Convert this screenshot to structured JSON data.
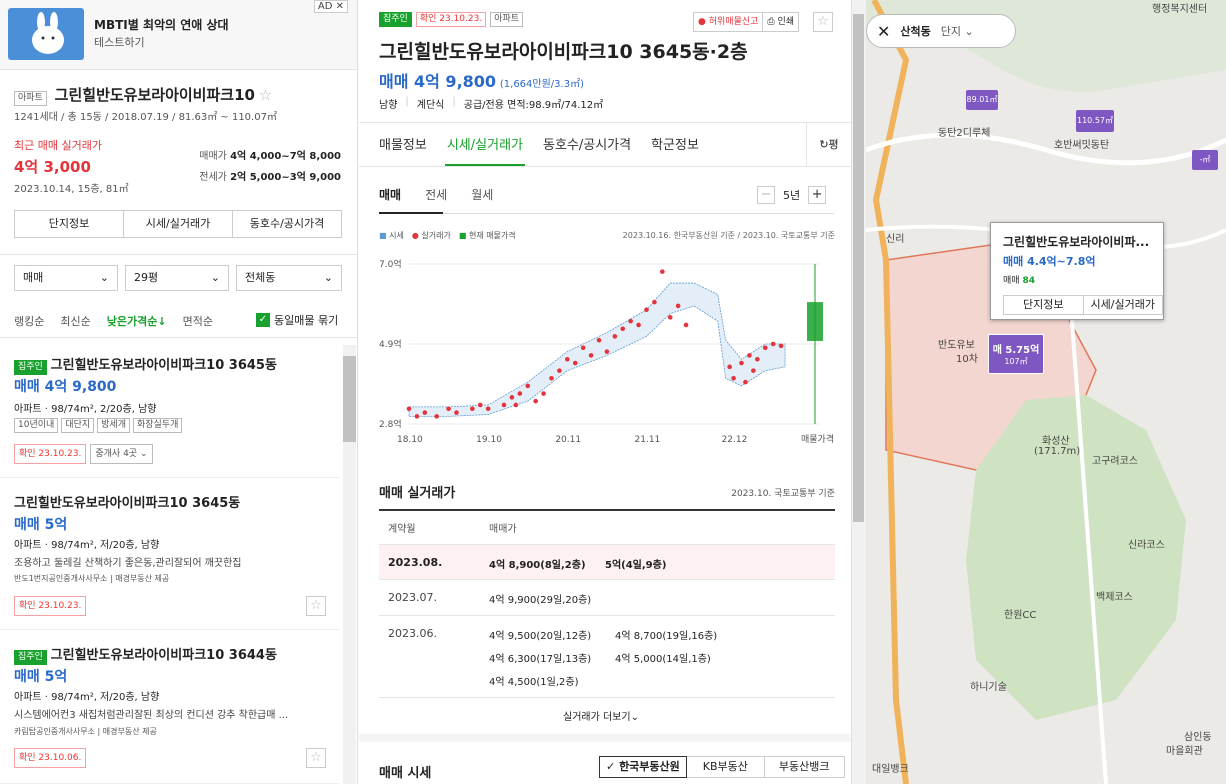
{
  "ad": {
    "title": "MBTI별 최악의 연애 상대",
    "subtitle": "테스트하기",
    "adlabel": "AD",
    "close": "✕"
  },
  "complex": {
    "type_tag": "아파트",
    "name": "그린힐반도유보라아이비파크10",
    "meta": "1241세대 / 총 15동 / 2018.07.19 / 81.63㎡ ~ 110.07㎡",
    "recent_label": "최근 매매 실거래가",
    "recent_price": "4억 3,000",
    "recent_detail": "2023.10.14, 15층, 81㎡",
    "sale_label": "매매가",
    "sale_range": "4억 4,000~7억 8,000",
    "rent_label": "전세가",
    "rent_range": "2억 5,000~3억 9,000",
    "buttons": [
      "단지정보",
      "시세/실거래가",
      "동호수/공시가격"
    ]
  },
  "filters": {
    "deal": "매매",
    "size": "29평",
    "dong": "전체동"
  },
  "sort": {
    "items": [
      "랭킹순",
      "최신순",
      "낮은가격순↓",
      "면적순"
    ],
    "bundle": "동일매물 묶기"
  },
  "listings": [
    {
      "owner_tag": "집주인",
      "title": "그린힐반도유보라아이비파크10 3645동",
      "price": "매매 4억 9,800",
      "spec": "아파트 · 98/74m², 2/20층, 남향",
      "tags": [
        "10년이내",
        "대단지",
        "방세개",
        "화장실두개"
      ],
      "confirm": "확인 23.10.23.",
      "agents": "중개사 4곳"
    },
    {
      "title": "그린힐반도유보라아이비파크10 3645동",
      "price": "매매 5억",
      "spec": "아파트 · 98/74m², 저/20층, 남향",
      "desc": "조용하고 둘레길 산책하기 좋은동,관리잘되어 깨끗한집",
      "agency": "반도1번지공인중개사사무소",
      "provider": "매경부동산 제공",
      "confirm": "확인 23.10.23."
    },
    {
      "owner_tag": "집주인",
      "title": "그린힐반도유보라아이비파크10 3644동",
      "price": "매매 5억",
      "spec": "아파트 · 98/74m², 저/20층, 남향",
      "desc": "시스템에어컨3 새집처럼관리잘된 최상의 컨디션 강추 착한급매 ...",
      "agency": "카림탑공인중개사사무소",
      "provider": "매경부동산 제공",
      "confirm": "확인 23.10.06."
    }
  ],
  "detail": {
    "owner_tag": "집주인",
    "confirm_tag": "확인 23.10.23.",
    "type_tag": "아파트",
    "report": "허위매물신고",
    "print": "인쇄",
    "title": "그린힐반도유보라아이비파크10 3645동·2층",
    "price": "매매 4억 9,800",
    "unit_price": "(1,664만원/3.3㎡)",
    "info": [
      "남향",
      "계단식",
      "공급/전용 면적:98.9㎡/74.12㎡"
    ],
    "tabs": [
      "매물정보",
      "시세/실거래가",
      "동호수/공시가격",
      "학군정보"
    ],
    "unit_toggle": "평",
    "subtabs": [
      "매매",
      "전세",
      "월세"
    ],
    "period": "5년",
    "minus": "−",
    "plus": "+"
  },
  "chart_data": {
    "type": "scatter",
    "legend": [
      "시세",
      "실거래가",
      "현재 매물가격"
    ],
    "source": "2023.10.16. 한국부동산원 기준 / 2023.10. 국토교통부 기준",
    "y_ticks": [
      "7.0억",
      "4.9억",
      "2.8억"
    ],
    "ylim": [
      2.8,
      7.0
    ],
    "x_ticks": [
      "18.10",
      "19.10",
      "20.11",
      "21.11",
      "22.12",
      "매물가격"
    ],
    "colors": {
      "band": "#5d9bd5",
      "point": "#e3343c",
      "current": "#18a12c"
    },
    "points": [
      [
        0,
        3.2
      ],
      [
        0.1,
        3.0
      ],
      [
        0.2,
        3.1
      ],
      [
        0.35,
        3.0
      ],
      [
        0.5,
        3.2
      ],
      [
        0.6,
        3.1
      ],
      [
        0.8,
        3.2
      ],
      [
        0.9,
        3.3
      ],
      [
        1.0,
        3.2
      ],
      [
        1.2,
        3.3
      ],
      [
        1.3,
        3.5
      ],
      [
        1.35,
        3.3
      ],
      [
        1.4,
        3.6
      ],
      [
        1.5,
        3.8
      ],
      [
        1.6,
        3.4
      ],
      [
        1.7,
        3.6
      ],
      [
        1.8,
        4.0
      ],
      [
        1.9,
        4.2
      ],
      [
        2.0,
        4.5
      ],
      [
        2.1,
        4.4
      ],
      [
        2.2,
        4.8
      ],
      [
        2.3,
        4.6
      ],
      [
        2.4,
        5.0
      ],
      [
        2.5,
        4.7
      ],
      [
        2.6,
        5.1
      ],
      [
        2.7,
        5.3
      ],
      [
        2.8,
        5.5
      ],
      [
        2.9,
        5.4
      ],
      [
        3.0,
        5.8
      ],
      [
        3.1,
        6.0
      ],
      [
        3.2,
        6.8
      ],
      [
        3.3,
        5.6
      ],
      [
        3.4,
        5.9
      ],
      [
        3.5,
        5.4
      ],
      [
        4.05,
        4.3
      ],
      [
        4.1,
        4.0
      ],
      [
        4.2,
        4.4
      ],
      [
        4.25,
        3.9
      ],
      [
        4.3,
        4.6
      ],
      [
        4.35,
        4.2
      ],
      [
        4.4,
        4.5
      ],
      [
        4.5,
        4.8
      ],
      [
        4.6,
        4.9
      ],
      [
        4.7,
        4.85
      ]
    ],
    "band_upper": [
      [
        0,
        3.25
      ],
      [
        0.5,
        3.25
      ],
      [
        1.0,
        3.3
      ],
      [
        1.5,
        3.9
      ],
      [
        2.0,
        4.7
      ],
      [
        2.5,
        5.2
      ],
      [
        3.0,
        5.8
      ],
      [
        3.3,
        6.5
      ],
      [
        3.6,
        6.5
      ],
      [
        3.9,
        6.2
      ],
      [
        4.0,
        5.0
      ],
      [
        4.2,
        4.5
      ],
      [
        4.5,
        4.9
      ],
      [
        4.75,
        4.9
      ]
    ],
    "band_lower": [
      [
        0,
        3.0
      ],
      [
        0.5,
        3.0
      ],
      [
        1.0,
        3.05
      ],
      [
        1.5,
        3.4
      ],
      [
        2.0,
        4.2
      ],
      [
        2.5,
        4.6
      ],
      [
        3.0,
        5.1
      ],
      [
        3.3,
        5.7
      ],
      [
        3.6,
        5.9
      ],
      [
        3.9,
        5.5
      ],
      [
        4.0,
        4.0
      ],
      [
        4.2,
        3.8
      ],
      [
        4.5,
        4.2
      ],
      [
        4.75,
        4.3
      ]
    ],
    "current_range": [
      4.98,
      6.0
    ]
  },
  "transactions": {
    "heading": "매매 실거래가",
    "source": "2023.10. 국토교통부 기준",
    "col_date": "계약월",
    "col_price": "매매가",
    "rows": [
      {
        "month": "2023.08.",
        "items": [
          "4억 8,900(8일,2층)",
          "5억(4일,9층)"
        ]
      },
      {
        "month": "2023.07.",
        "items": [
          "4억 9,900(29일,20층)"
        ]
      },
      {
        "month": "2023.06.",
        "items": [
          "4억 9,500(20일,12층)",
          "4억 8,700(19일,16층)",
          "4억 6,300(17일,13층)",
          "4억 5,000(14일,1층)",
          "4억 4,500(1일,2층)"
        ]
      }
    ],
    "more": "실거래가 더보기"
  },
  "market": {
    "heading": "매매 시세",
    "sources": [
      "한국부동산원",
      "KB부동산",
      "부동산뱅크"
    ]
  },
  "map": {
    "region": "산척동",
    "mode": "단지",
    "popup_title": "그린힐반도유보라아이비파...",
    "popup_range": "매매 4.4억~7.8억",
    "popup_count_label": "매매",
    "popup_count": "84",
    "popup_btns": [
      "단지정보",
      "시세/실거래가"
    ],
    "pin_main": "매 5.75억",
    "pin_main_sub": "107㎡",
    "labels": [
      "동탄2디루체",
      "호반써밋동탄",
      "신리",
      "반도유보",
      "10차",
      "화성산",
      "(171.7m)",
      "고구려코스",
      "신라코스",
      "백제코스",
      "한원CC",
      "하니기술",
      "대일뱅크",
      "삼인동",
      "마을회관",
      "행정복지센터"
    ],
    "pins": [
      "89.01㎡",
      "110.57㎡",
      "-㎡"
    ]
  }
}
